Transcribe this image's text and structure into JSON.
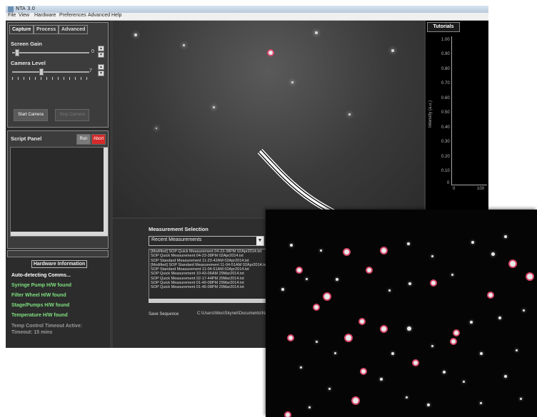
{
  "window": {
    "title": "NTA 3.0",
    "menu": [
      "File",
      "View",
      "Hardware",
      "Preferences",
      "Advanced",
      "Help"
    ]
  },
  "capture_panel": {
    "tabs": [
      "Capture",
      "Process",
      "Advanced"
    ],
    "screen_gain_label": "Screen Gain",
    "screen_gain_value": "0",
    "camera_level_label": "Camera Level",
    "camera_level_value": "7",
    "start_camera_label": "Start Camera",
    "disabled_button_label": "Stop Camera"
  },
  "script_panel": {
    "title": "Script Panel",
    "run_label": "Run",
    "abort_label": "Abort",
    "run_color": "#7a7a7a",
    "abort_color": "#d42a2a"
  },
  "hardware": {
    "title": "Hardware Information",
    "lines": [
      {
        "text": "Auto-detecting Comms...",
        "color": "#ffffff"
      },
      {
        "text": "Syringe Pump H/W found",
        "color": "#7fe07f"
      },
      {
        "text": "Filter Wheel H/W found",
        "color": "#7fe07f"
      },
      {
        "text": "Stage/Pumps H/W found",
        "color": "#7fe07f"
      },
      {
        "text": "Temperature H/W found",
        "color": "#7fe07f"
      },
      {
        "text": "Temp Control Timeout Active:",
        "color": "#9a9a9a"
      },
      {
        "text": "Timeout: 15 mins",
        "color": "#9a9a9a"
      }
    ]
  },
  "tutorials": {
    "tab": "Tutorials",
    "y_ticks": [
      "1.00",
      "0.90",
      "0.80",
      "0.70",
      "0.60",
      "0.50",
      "0.40",
      "0.30",
      "0.20",
      "0.10",
      "0"
    ],
    "y_label": "Intensity (a.u.)",
    "x_ticks": [
      "0",
      "100"
    ]
  },
  "measurement": {
    "title": "Measurement Selection",
    "dropdown_value": "Recent Measurements",
    "items": [
      "[Modified] SOP Quick Measurement 04-23-38PM 02Apr2014.txt",
      "SOP Quick Measurement 04-23-38PM 02Apr2014.txt",
      "SOP Standard Measurement 11-23-42AM 02Apr2014.txt",
      "[Modified] SOP Standard Measurement 11-04-51AM 02Apr2014.txt",
      "SOP Standard Measurement 11-04-51AM 02Apr2014.txt",
      "SOP Quick Measurement 10-43-06AM 29Mar2014.txt",
      "SOP Quick Measurement 02-17-44PM 29Mar2014.txt",
      "SOP Quick Measurement 01-49-08PM 29Mar2014.txt",
      "SOP Quick Measurement 01-46-08PM 29Mar2014.txt"
    ],
    "save_label": "Save Sequence",
    "save_path": "C:\\Users\\Wes\\Skynet\\Documents\\Nanosight"
  }
}
